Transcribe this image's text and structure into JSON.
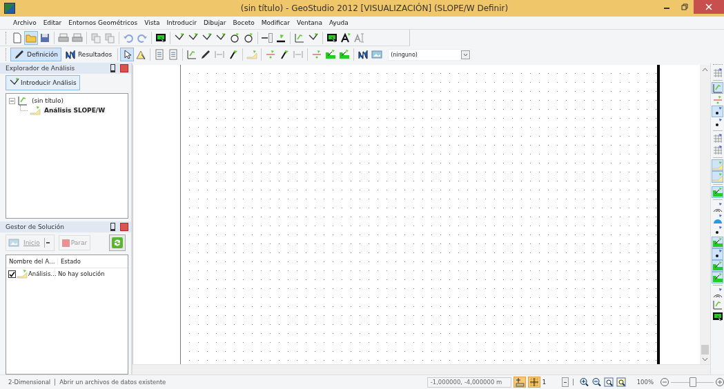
{
  "window": {
    "title": "(sin título) - GeoStudio 2012 [VISUALIZACIÓN] (SLOPE/W Definir)"
  },
  "menu": [
    "Archivo",
    "Editar",
    "Entornos Geométricos",
    "Vista",
    "Introducir",
    "Dibujar",
    "Boceto",
    "Modificar",
    "Ventana",
    "Ayuda"
  ],
  "modes": [
    {
      "label": "Definición",
      "selected": true
    },
    {
      "label": "Resultados",
      "selected": false
    }
  ],
  "view_dropdown": {
    "value": "(ninguno)"
  },
  "explorer": {
    "title": "Explorador de Análisis",
    "button": "Introducir Análisis",
    "tree": [
      {
        "label": "(sin título)",
        "expanded": true,
        "children": [
          {
            "label": "Análisis SLOPE/W",
            "bold": true
          }
        ]
      }
    ]
  },
  "solver": {
    "title": "Gestor de Solución",
    "start": {
      "label": "Inicio",
      "disabled": true
    },
    "stop": {
      "label": "Parar",
      "disabled": true
    },
    "columns": [
      "Nombre del A…",
      "Estado"
    ],
    "rows": [
      {
        "checked": true,
        "name": "Análisis…",
        "status": "No hay solución"
      }
    ]
  },
  "status_bar": {
    "mode": "2-Dimensional",
    "message": "Abrir un archivos de datos existente",
    "coordinates": "-1,000000, -4,000000 m",
    "snap_on": true,
    "grid_on": true,
    "spin": "1",
    "zoom": "100%",
    "zoom_slider": {
      "level": 0.5
    }
  }
}
